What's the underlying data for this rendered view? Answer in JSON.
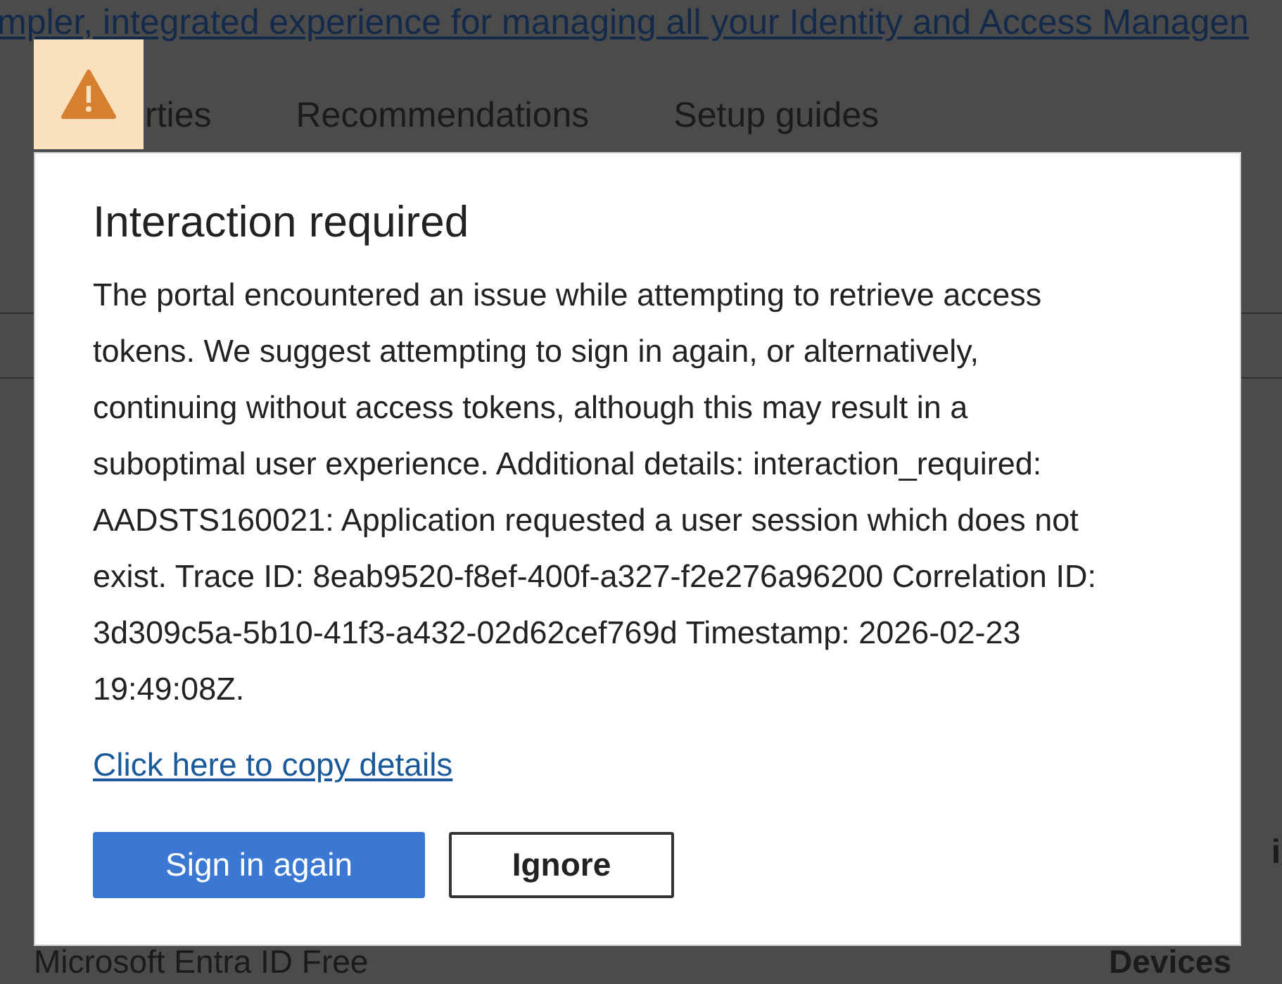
{
  "banner_link": "mpler, integrated experience for managing all your Identity and Access Managen",
  "tabs": [
    {
      "label": "rties"
    },
    {
      "label": "Recommendations"
    },
    {
      "label": "Setup guides"
    }
  ],
  "background_rows": [
    {
      "left": "Microsoft Entra ID Free",
      "right": "Devices"
    }
  ],
  "background_edge_text": "i",
  "dialog": {
    "title": "Interaction required",
    "message": "The portal encountered an issue while attempting to retrieve access tokens. We suggest attempting to sign in again, or alternatively, continuing without access tokens, although this may result in a suboptimal user experience. Additional details: interaction_required: AADSTS160021: Application requested a user session which does not exist. Trace ID: 8eab9520-f8ef-400f-a327-f2e276a96200 Correlation ID: 3d309c5a-5b10-41f3-a432-02d62cef769d Timestamp: 2026-02-23 19:49:08Z.",
    "copy_link": "Click here to copy details",
    "buttons": [
      {
        "label": "Sign in again",
        "kind": "primary"
      },
      {
        "label": "Ignore",
        "kind": "secondary"
      }
    ]
  }
}
